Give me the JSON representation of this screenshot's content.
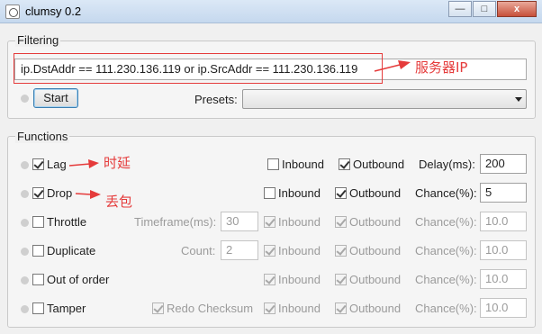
{
  "window": {
    "title": "clumsy 0.2",
    "minimize_label": "—",
    "maximize_label": "□",
    "close_label": "x"
  },
  "filtering": {
    "title": "Filtering",
    "filter_value": "ip.DstAddr == 111.230.136.119 or ip.SrcAddr == 111.230.136.119",
    "start_label": "Start",
    "presets_label": "Presets:",
    "presets_value": ""
  },
  "annotations": {
    "server_ip": "服务器IP",
    "lag": "时延",
    "drop": "丢包"
  },
  "functions": {
    "title": "Functions",
    "rows": [
      {
        "name": "Lag",
        "checked": true,
        "inbound_label": "Inbound",
        "inbound": false,
        "outbound_label": "Outbound",
        "outbound": true,
        "param_label": "Delay(ms):",
        "param_value": "200"
      },
      {
        "name": "Drop",
        "checked": true,
        "inbound_label": "Inbound",
        "inbound": false,
        "outbound_label": "Outbound",
        "outbound": true,
        "param_label": "Chance(%):",
        "param_value": "5"
      },
      {
        "name": "Throttle",
        "checked": false,
        "extra_label": "Timeframe(ms):",
        "extra_value": "30",
        "inbound_label": "Inbound",
        "inbound": true,
        "outbound_label": "Outbound",
        "outbound": true,
        "param_label": "Chance(%):",
        "param_value": "10.0"
      },
      {
        "name": "Duplicate",
        "checked": false,
        "extra_label": "Count:",
        "extra_value": "2",
        "inbound_label": "Inbound",
        "inbound": true,
        "outbound_label": "Outbound",
        "outbound": true,
        "param_label": "Chance(%):",
        "param_value": "10.0"
      },
      {
        "name": "Out of order",
        "checked": false,
        "inbound_label": "Inbound",
        "inbound": true,
        "outbound_label": "Outbound",
        "outbound": true,
        "param_label": "Chance(%):",
        "param_value": "10.0"
      },
      {
        "name": "Tamper",
        "checked": false,
        "extra_label": "Redo Checksum",
        "extra_checked": true,
        "inbound_label": "Inbound",
        "inbound": true,
        "outbound_label": "Outbound",
        "outbound": true,
        "param_label": "Chance(%):",
        "param_value": "10.0"
      }
    ]
  },
  "colors": {
    "annotation": "#e53b3b",
    "titlebar": "#c5d8ee",
    "close_button": "#c7503a"
  }
}
